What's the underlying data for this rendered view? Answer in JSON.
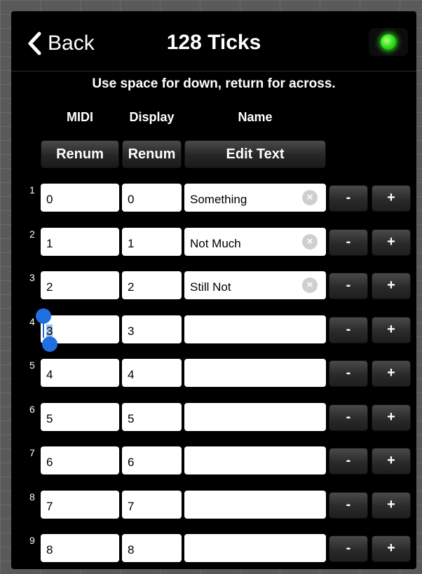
{
  "navbar": {
    "back_label": "Back",
    "title": "128 Ticks"
  },
  "instructions": "Use space for down, return for across.",
  "columns": {
    "midi": "MIDI",
    "display": "Display",
    "name": "Name"
  },
  "header_buttons": {
    "midi_renum": "Renum",
    "display_renum": "Renum",
    "edit_text": "Edit Text"
  },
  "row_buttons": {
    "minus": "-",
    "plus": "+"
  },
  "clear_glyph": "×",
  "rows": [
    {
      "num": "1",
      "midi": "0",
      "display": "0",
      "name": "Something"
    },
    {
      "num": "2",
      "midi": "1",
      "display": "1",
      "name": "Not Much"
    },
    {
      "num": "3",
      "midi": "2",
      "display": "2",
      "name": "Still Not"
    },
    {
      "num": "4",
      "midi": "3",
      "display": "3",
      "name": ""
    },
    {
      "num": "5",
      "midi": "4",
      "display": "4",
      "name": ""
    },
    {
      "num": "6",
      "midi": "5",
      "display": "5",
      "name": ""
    },
    {
      "num": "7",
      "midi": "6",
      "display": "6",
      "name": ""
    },
    {
      "num": "8",
      "midi": "7",
      "display": "7",
      "name": ""
    },
    {
      "num": "9",
      "midi": "8",
      "display": "8",
      "name": ""
    }
  ],
  "status_led": {
    "color": "#36e820"
  }
}
